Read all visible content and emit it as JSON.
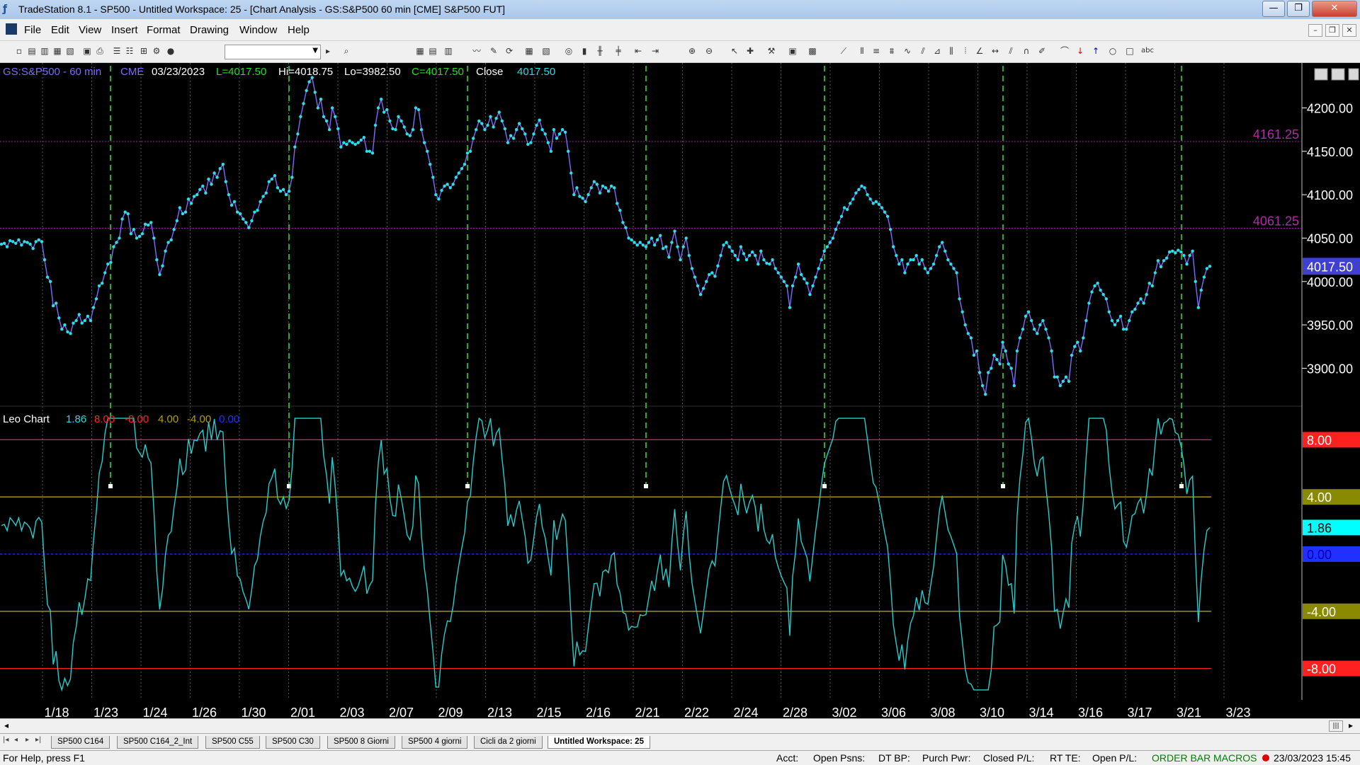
{
  "window": {
    "title": "TradeStation 8.1 - SP500 - Untitled Workspace:  25 - [Chart Analysis - GS:S&P500  60 min  [CME] S&P500 FUT]",
    "min": "—",
    "max": "❐",
    "close": "✕"
  },
  "menu": {
    "items": [
      "File",
      "Edit",
      "View",
      "Insert",
      "Format",
      "Drawing",
      "Window",
      "Help"
    ]
  },
  "chart_header": {
    "symbol": "GS:S&P500 - 60 min",
    "exchange": "CME",
    "date": "03/23/2023",
    "last": "L=4017.50",
    "high": "Hi=4018.75",
    "low": "Lo=3982.50",
    "close": "C=4017.50",
    "close_label": "Close",
    "close_value": "4017.50"
  },
  "indicator_header": {
    "name": "Leo Chart",
    "v1": "1.86",
    "v2": "8.00",
    "v3": "-8.00",
    "v4": "4.00",
    "v5": "-4.00",
    "v6": "0.00"
  },
  "chart_data": [
    {
      "type": "line",
      "title": "GS:S&P500 - 60 min",
      "price_axis_ticks": [
        "4200.00",
        "4150.00",
        "4100.00",
        "4050.00",
        "4000.00",
        "3950.00",
        "3900.00"
      ],
      "ylim": [
        3862,
        4242
      ],
      "reference_lines": [
        {
          "label": "4161.25",
          "value": 4161.25
        },
        {
          "label": "4061.25",
          "value": 4061.25
        }
      ],
      "last_price_tag": "4017.50",
      "x_date_labels": [
        "1/18",
        "1/23",
        "1/24",
        "1/26",
        "1/30",
        "2/01",
        "2/03",
        "2/07",
        "2/09",
        "2/13",
        "2/15",
        "2/16",
        "2/21",
        "2/22",
        "2/24",
        "2/28",
        "3/02",
        "3/06",
        "3/08",
        "3/10",
        "3/14",
        "3/16",
        "3/17",
        "3/21",
        "3/23"
      ],
      "y": [
        4043,
        4044,
        4040,
        4047,
        4046,
        4044,
        4048,
        4042,
        4046,
        4045,
        4043,
        4038,
        4046,
        4048,
        4046,
        4025,
        4005,
        4000,
        3972,
        3975,
        3958,
        3945,
        3950,
        3942,
        3940,
        3952,
        3955,
        3962,
        3952,
        3955,
        3960,
        3955,
        3970,
        3980,
        3995,
        3998,
        4010,
        4020,
        4022,
        4040,
        4045,
        4050,
        4072,
        4080,
        4078,
        4055,
        4060,
        4050,
        4052,
        4055,
        4066,
        4065,
        4068,
        4050,
        4025,
        4008,
        4018,
        4035,
        4045,
        4048,
        4060,
        4070,
        4085,
        4078,
        4080,
        4095,
        4090,
        4098,
        4100,
        4106,
        4110,
        4102,
        4118,
        4112,
        4125,
        4120,
        4130,
        4135,
        4115,
        4100,
        4088,
        4092,
        4080,
        4078,
        4072,
        4068,
        4062,
        4070,
        4080,
        4082,
        4092,
        4098,
        4102,
        4115,
        4118,
        4122,
        4108,
        4104,
        4106,
        4100,
        4104,
        4120,
        4155,
        4170,
        4190,
        4205,
        4220,
        4230,
        4235,
        4218,
        4200,
        4210,
        4190,
        4185,
        4175,
        4200,
        4190,
        4176,
        4155,
        4160,
        4158,
        4162,
        4160,
        4158,
        4160,
        4163,
        4166,
        4150,
        4150,
        4148,
        4180,
        4200,
        4210,
        4195,
        4198,
        4185,
        4176,
        4175,
        4190,
        4185,
        4178,
        4170,
        4168,
        4175,
        4200,
        4198,
        4175,
        4160,
        4150,
        4135,
        4120,
        4100,
        4095,
        4105,
        4110,
        4112,
        4108,
        4112,
        4120,
        4125,
        4130,
        4135,
        4148,
        4150,
        4165,
        4175,
        4185,
        4182,
        4175,
        4180,
        4190,
        4178,
        4188,
        4195,
        4185,
        4176,
        4160,
        4168,
        4165,
        4175,
        4182,
        4176,
        4170,
        4158,
        4160,
        4170,
        4180,
        4186,
        4175,
        4170,
        4160,
        4150,
        4175,
        4165,
        4170,
        4175,
        4172,
        4150,
        4125,
        4100,
        4108,
        4098,
        4096,
        4092,
        4100,
        4108,
        4115,
        4112,
        4102,
        4110,
        4108,
        4104,
        4110,
        4108,
        4090,
        4082,
        4068,
        4062,
        4050,
        4048,
        4045,
        4042,
        4045,
        4042,
        4040,
        4045,
        4050,
        4042,
        4048,
        4053,
        4038,
        4040,
        4028,
        4045,
        4058,
        4040,
        4025,
        4040,
        4050,
        4030,
        4015,
        4005,
        3995,
        3985,
        3992,
        4000,
        4008,
        4010,
        4006,
        4018,
        4030,
        4042,
        4045,
        4040,
        4035,
        4030,
        4025,
        4040,
        4032,
        4025,
        4030,
        4034,
        4030,
        4020,
        4035,
        4025,
        4021,
        4020,
        4025,
        4015,
        4010,
        4005,
        4000,
        3995,
        3970,
        3995,
        4005,
        4020,
        4008,
        4003,
        3998,
        3985,
        3995,
        4005,
        4015,
        4025,
        4035,
        4040,
        4045,
        4050,
        4060,
        4068,
        4075,
        4085,
        4083,
        4090,
        4095,
        4102,
        4106,
        4110,
        4108,
        4100,
        4095,
        4090,
        4092,
        4089,
        4085,
        4080,
        4075,
        4060,
        4040,
        4030,
        4020,
        4025,
        4010,
        4020,
        4025,
        4025,
        4030,
        4020,
        4025,
        4015,
        4010,
        4015,
        4020,
        4030,
        4040,
        4045,
        4035,
        4025,
        4020,
        4015,
        4010,
        3980,
        3965,
        3950,
        3940,
        3935,
        3915,
        3920,
        3895,
        3880,
        3870,
        3895,
        3900,
        3915,
        3910,
        3905,
        3930,
        3920,
        3905,
        3900,
        3880,
        3920,
        3935,
        3945,
        3960,
        3965,
        3955,
        3945,
        3940,
        3950,
        3955,
        3945,
        3935,
        3920,
        3890,
        3890,
        3880,
        3885,
        3890,
        3885,
        3915,
        3925,
        3930,
        3920,
        3935,
        3955,
        3975,
        3988,
        3995,
        3998,
        3990,
        3985,
        3980,
        3965,
        3955,
        3950,
        3955,
        3960,
        3945,
        3945,
        3955,
        3965,
        3968,
        3975,
        3980,
        3975,
        3985,
        3998,
        3995,
        4010,
        4024,
        4017,
        4024,
        4027,
        4034,
        4035,
        4033,
        4036,
        4034,
        4030,
        4020,
        4030,
        4035,
        4000,
        3970,
        3990,
        4005,
        4015,
        4017.5
      ]
    },
    {
      "type": "line",
      "title": "Leo Chart",
      "axis_tags": [
        "8.00",
        "4.00",
        "1.86",
        "0.00",
        "-4.00",
        "-8.00"
      ],
      "ylim": [
        -10,
        10
      ],
      "levels": [
        {
          "label": "8.00",
          "value": 8,
          "color": "#ff2020"
        },
        {
          "label": "-8.00",
          "value": -8,
          "color": "#ff2020"
        },
        {
          "label": "4.00",
          "value": 4,
          "color": "#b0a000"
        },
        {
          "label": "-4.00",
          "value": -4,
          "color": "#b0a000"
        },
        {
          "label": "0.00",
          "value": 0,
          "color": "#2030ff"
        }
      ],
      "last_value": 1.86,
      "y": []
    }
  ],
  "colors": {
    "price_line": "#7a6cff",
    "price_dot": "#2ae0e8",
    "indicator_line": "#20d0d0",
    "cycle_line": "#20b020",
    "ref_line": "#a020a0",
    "ref_text": "#b02aa8",
    "axis_text": "#ffffff",
    "last_price_bg": "#4040d0"
  },
  "tabs": [
    "SP500 C164",
    "SP500 C164_2_Int",
    "SP500 C55",
    "SP500 C30",
    "SP500 8 Giorni",
    "SP500 4 giorni",
    "Cicli da 2 giorni",
    "Untitled Workspace:  25"
  ],
  "statusbar": {
    "help": "For Help, press F1",
    "acct": "Acct:",
    "open_psns": "Open Psns:",
    "dt_bp": "DT BP:",
    "purch_pwr": "Purch Pwr:",
    "closed_pl": "Closed P/L:",
    "rt_te": "RT TE:",
    "open_pl": "Open P/L:",
    "order_bar": "ORDER BAR",
    "macros": "MACROS",
    "datetime": "23/03/2023 15:45"
  }
}
